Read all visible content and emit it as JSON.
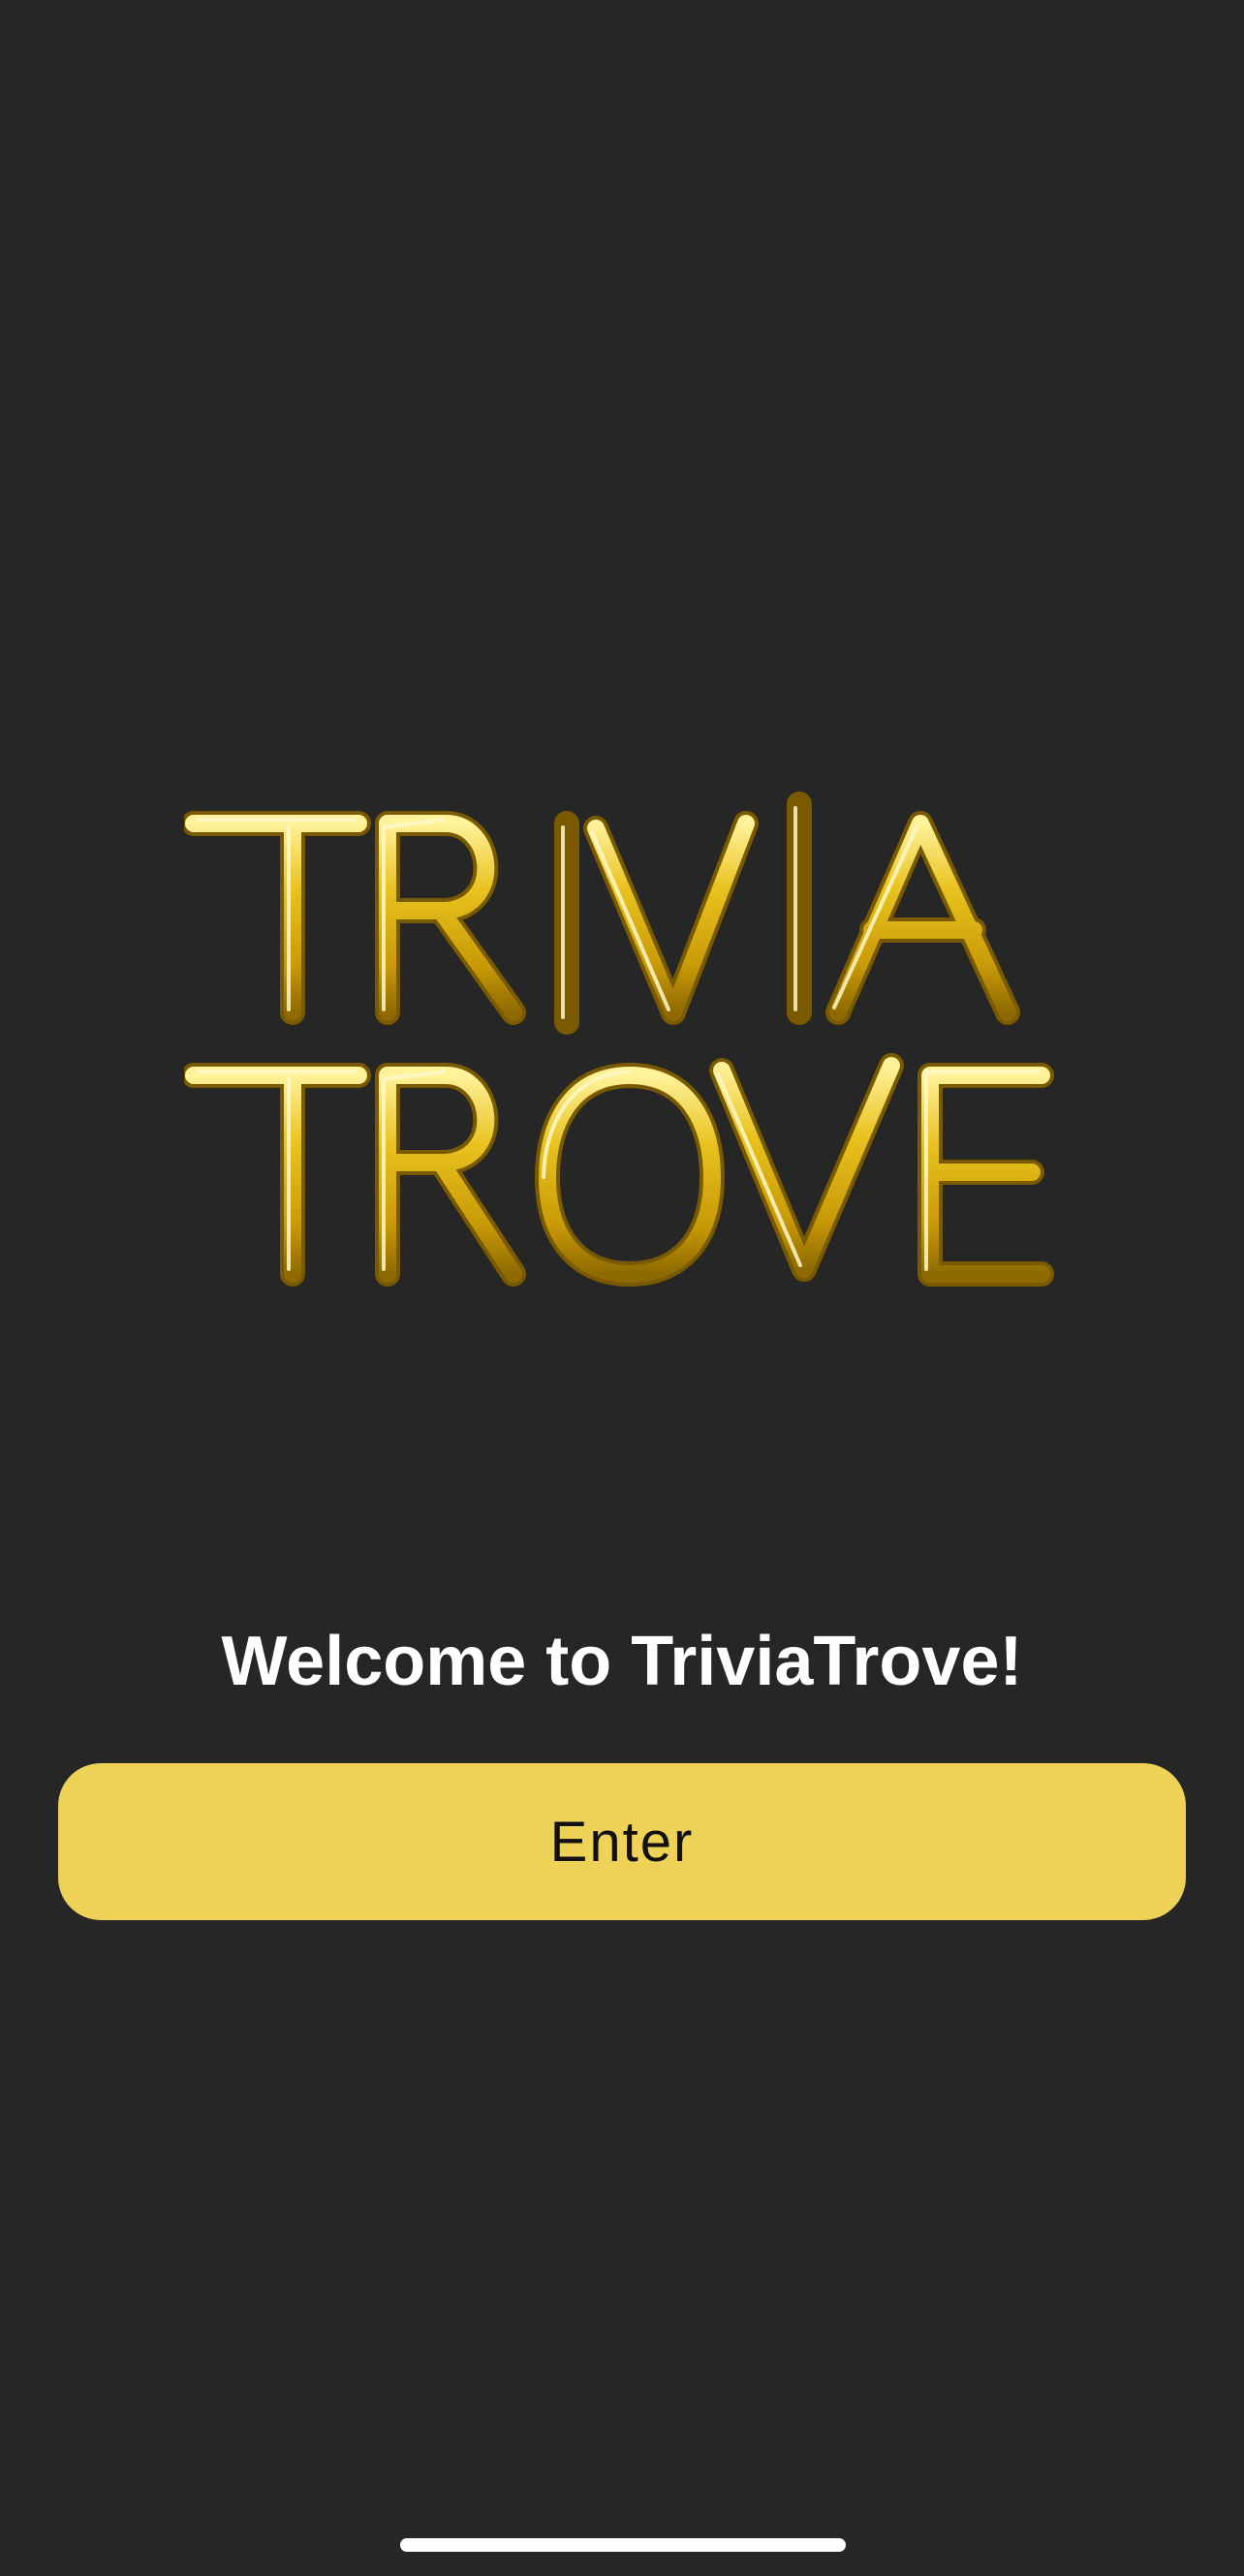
{
  "app": {
    "logo_text": "TRIVIA TROVE",
    "welcome_text": "Welcome to TriviaTrove!",
    "enter_button_label": "Enter"
  },
  "colors": {
    "background": "#262626",
    "accent": "#EDD257",
    "logo_gold": "#E8C21E"
  }
}
